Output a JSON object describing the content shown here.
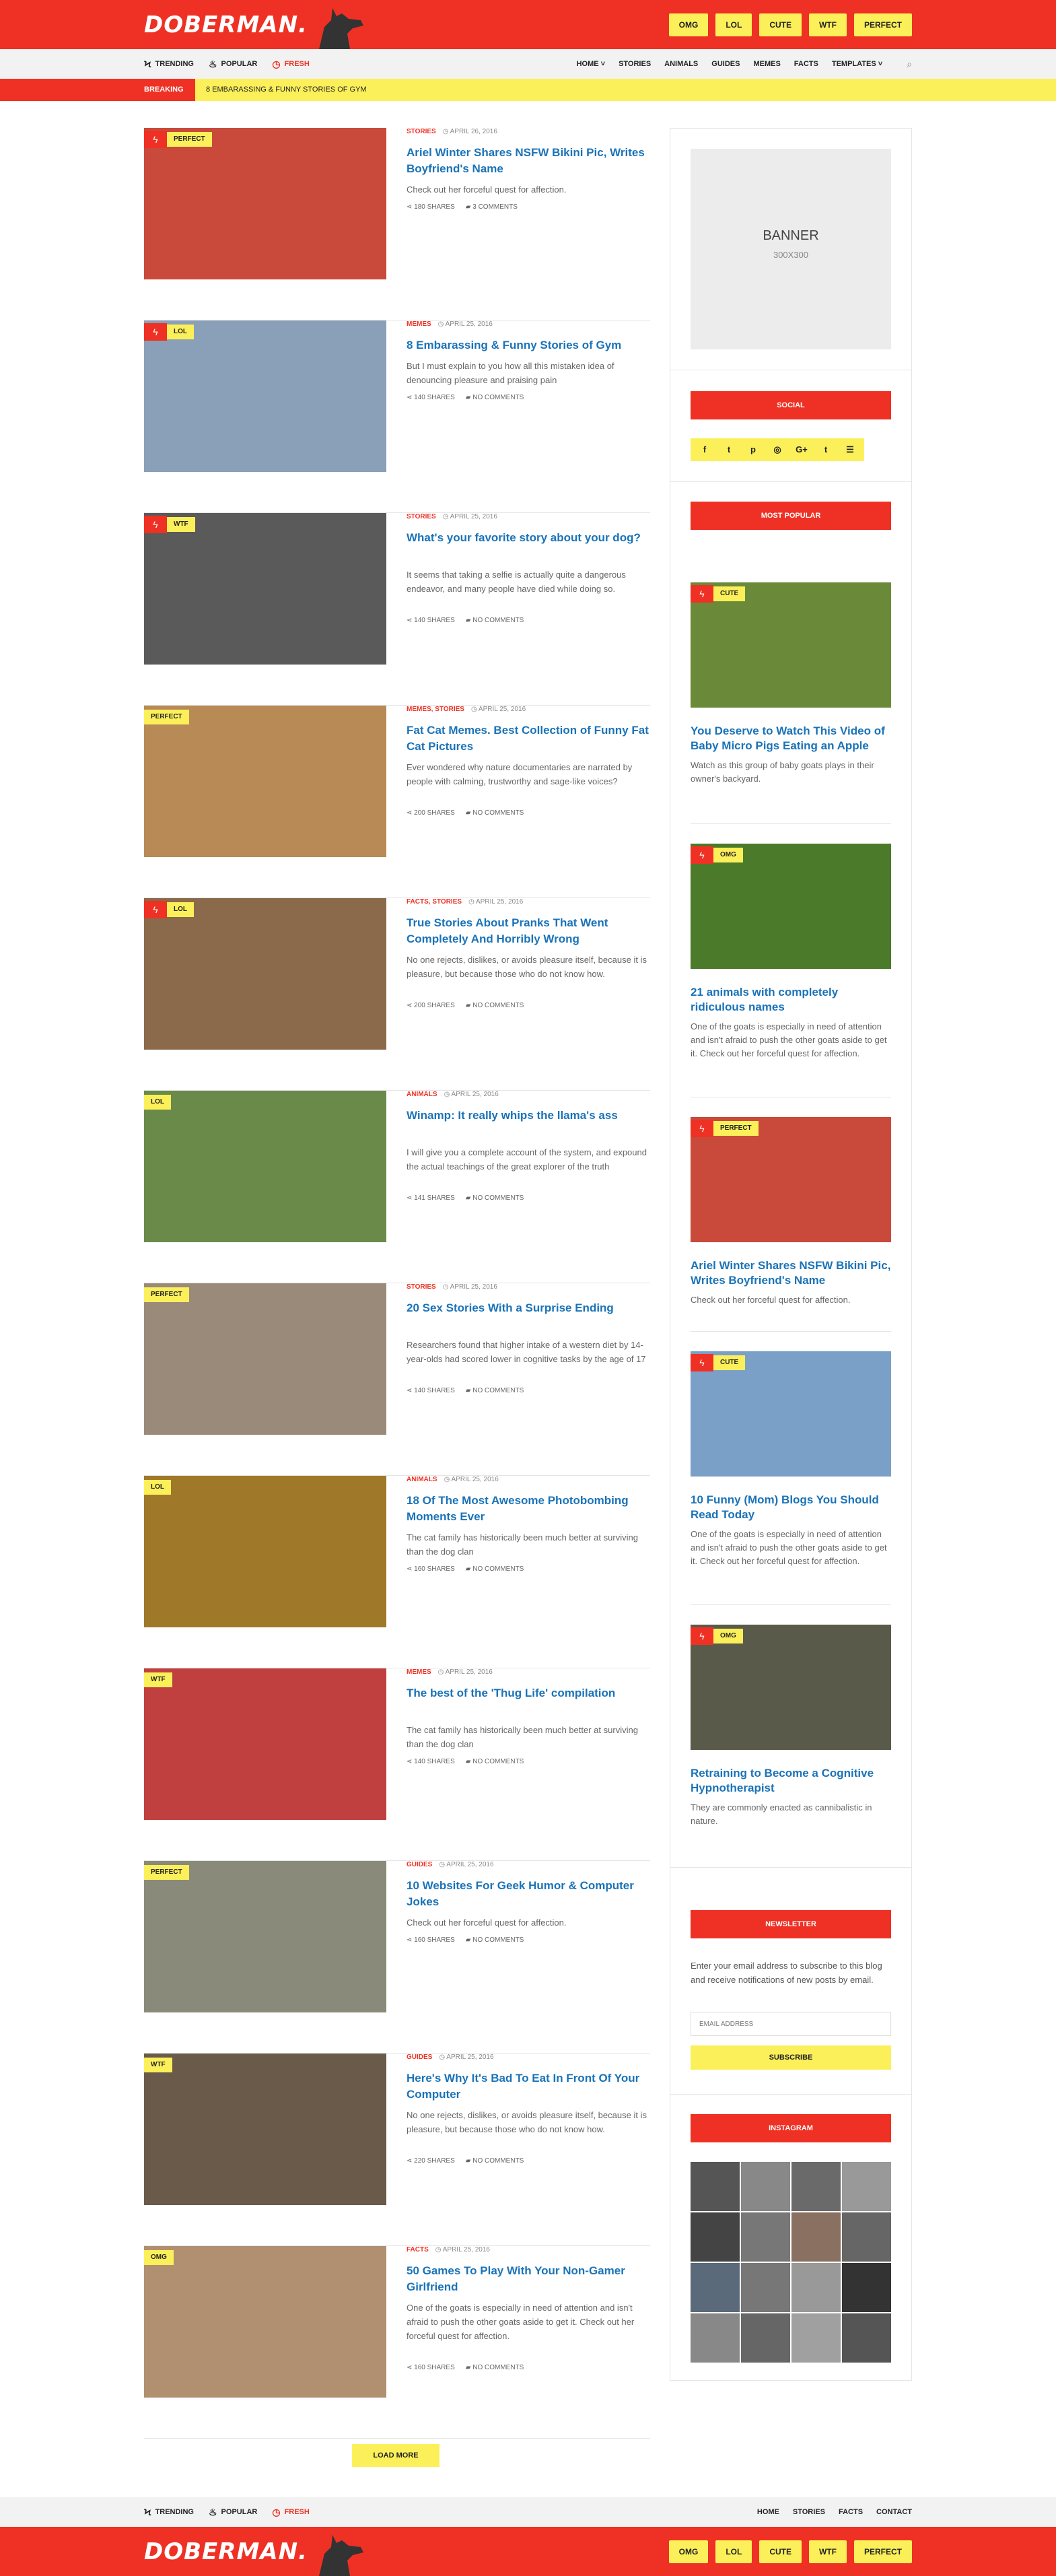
{
  "header": {
    "logo": "DOBERMAN.",
    "categories": [
      "OMG",
      "LOL",
      "CUTE",
      "WTF",
      "PERFECT"
    ]
  },
  "nav": {
    "tabs": [
      "TRENDING",
      "POPULAR",
      "FRESH"
    ],
    "links": [
      "HOME",
      "STORIES",
      "ANIMALS",
      "GUIDES",
      "MEMES",
      "FACTS",
      "TEMPLATES"
    ]
  },
  "breaking": {
    "label": "BREAKING",
    "text": "8 Embarassing & Funny Stories of Gym"
  },
  "articles": [
    {
      "hot": true,
      "badge": "PERFECT",
      "category": "STORIES",
      "date": "APRIL 26, 2016",
      "title": "Ariel Winter Shares NSFW Bikini Pic, Writes Boyfriend's Name",
      "excerpt": "Check out her forceful quest for affection.",
      "shares": "180 SHARES",
      "comments": "3 COMMENTS"
    },
    {
      "hot": true,
      "badge": "LOL",
      "category": "MEMES",
      "date": "APRIL 25, 2016",
      "title": "8 Embarassing & Funny Stories of Gym",
      "excerpt": "But I must explain to you how all this mistaken idea of denouncing pleasure and praising pain",
      "shares": "140 SHARES",
      "comments": "NO COMMENTS"
    },
    {
      "hot": true,
      "badge": "WTF",
      "category": "STORIES",
      "date": "APRIL 25, 2016",
      "title": "What's your favorite story about your dog?",
      "excerpt": "It seems that taking a selfie is actually quite a dangerous endeavor, and many people have died while doing so.",
      "shares": "140 SHARES",
      "comments": "NO COMMENTS"
    },
    {
      "hot": false,
      "badge": "PERFECT",
      "category": "MEMES, STORIES",
      "date": "APRIL 25, 2016",
      "title": "Fat Cat Memes. Best Collection of Funny Fat Cat Pictures",
      "excerpt": "Ever wondered why nature documentaries are narrated by people with calming, trustworthy and sage-like voices?",
      "shares": "200 SHARES",
      "comments": "NO COMMENTS"
    },
    {
      "hot": true,
      "badge": "LOL",
      "category": "FACTS, STORIES",
      "date": "APRIL 25, 2016",
      "title": "True Stories About Pranks That Went Completely And Horribly Wrong",
      "excerpt": "No one rejects, dislikes, or avoids pleasure itself, because it is pleasure, but because those who do not know how.",
      "shares": "200 SHARES",
      "comments": "NO COMMENTS"
    },
    {
      "hot": false,
      "badge": "LOL",
      "category": "ANIMALS",
      "date": "APRIL 25, 2016",
      "title": "Winamp: It really whips the llama's ass",
      "excerpt": "I will give you a complete account of the system, and expound the actual teachings of the great explorer of the truth",
      "shares": "141 SHARES",
      "comments": "NO COMMENTS"
    },
    {
      "hot": false,
      "badge": "PERFECT",
      "category": "STORIES",
      "date": "APRIL 25, 2016",
      "title": "20 Sex Stories With a Surprise Ending",
      "excerpt": "Researchers found that higher intake of a western diet by 14-year-olds had scored lower in cognitive tasks by the age of 17",
      "shares": "140 SHARES",
      "comments": "NO COMMENTS"
    },
    {
      "hot": false,
      "badge": "LOL",
      "category": "ANIMALS",
      "date": "APRIL 25, 2016",
      "title": "18 Of The Most Awesome Photobombing Moments Ever",
      "excerpt": "The cat family has historically been much better at surviving than the dog clan",
      "shares": "160 SHARES",
      "comments": "NO COMMENTS"
    },
    {
      "hot": false,
      "badge": "WTF",
      "category": "MEMES",
      "date": "APRIL 25, 2016",
      "title": "The best of the 'Thug Life' compilation",
      "excerpt": "The cat family has historically been much better at surviving than the dog clan",
      "shares": "140 SHARES",
      "comments": "NO COMMENTS"
    },
    {
      "hot": false,
      "badge": "PERFECT",
      "category": "GUIDES",
      "date": "APRIL 25, 2016",
      "title": "10 Websites For Geek Humor & Computer Jokes",
      "excerpt": "Check out her forceful quest for affection.",
      "shares": "160 SHARES",
      "comments": "NO COMMENTS"
    },
    {
      "hot": false,
      "badge": "WTF",
      "category": "GUIDES",
      "date": "APRIL 25, 2016",
      "title": "Here's Why It's Bad To Eat In Front Of Your Computer",
      "excerpt": "No one rejects, dislikes, or avoids pleasure itself, because it is pleasure, but because those who do not know how.",
      "shares": "220 SHARES",
      "comments": "NO COMMENTS"
    },
    {
      "hot": false,
      "badge": "OMG",
      "category": "FACTS",
      "date": "APRIL 25, 2016",
      "title": "50 Games To Play With Your Non-Gamer Girlfriend",
      "excerpt": "One of the goats is especially in need of attention and isn't afraid to push the other goats aside to get it. Check out her forceful quest for affection.",
      "shares": "160 SHARES",
      "comments": "NO COMMENTS"
    }
  ],
  "load_more": "LOAD MORE",
  "sidebar": {
    "banner_title": "BANNER",
    "banner_size": "300X300",
    "social_title": "SOCIAL",
    "social_icons": [
      "f",
      "t",
      "p",
      "◎",
      "G+",
      "t",
      "rss"
    ],
    "popular_title": "MOST POPULAR",
    "popular": [
      {
        "hot": true,
        "badge": "CUTE",
        "title": "You Deserve to Watch This Video of Baby Micro Pigs Eating an Apple",
        "excerpt": "Watch as this group of baby goats plays in their owner's backyard."
      },
      {
        "hot": true,
        "badge": "OMG",
        "title": "21 animals with completely ridiculous names",
        "excerpt": "One of the goats is especially in need of attention and isn't afraid to push the other goats aside to get it. Check out her forceful quest for affection."
      },
      {
        "hot": true,
        "badge": "PERFECT",
        "title": "Ariel Winter Shares NSFW Bikini Pic, Writes Boyfriend's Name",
        "excerpt": "Check out her forceful quest for affection."
      },
      {
        "hot": true,
        "badge": "CUTE",
        "title": "10 Funny (Mom) Blogs You Should Read Today",
        "excerpt": "One of the goats is especially in need of attention and isn't afraid to push the other goats aside to get it. Check out her forceful quest for affection."
      },
      {
        "hot": true,
        "badge": "OMG",
        "title": "Retraining to Become a Cognitive Hypnotherapist",
        "excerpt": "They are commonly enacted as cannibalistic in nature."
      }
    ],
    "newsletter_title": "NEWSLETTER",
    "newsletter_text": "Enter your email address to subscribe to this blog and receive notifications of new posts by email.",
    "email_placeholder": "EMAIL ADDRESS",
    "subscribe": "SUBSCRIBE",
    "instagram_title": "INSTAGRAM"
  },
  "footer": {
    "tabs": [
      "TRENDING",
      "POPULAR",
      "FRESH"
    ],
    "links": [
      "HOME",
      "STORIES",
      "FACTS",
      "CONTACT"
    ],
    "logo": "DOBERMAN.",
    "categories": [
      "OMG",
      "LOL",
      "CUTE",
      "WTF",
      "PERFECT"
    ]
  }
}
